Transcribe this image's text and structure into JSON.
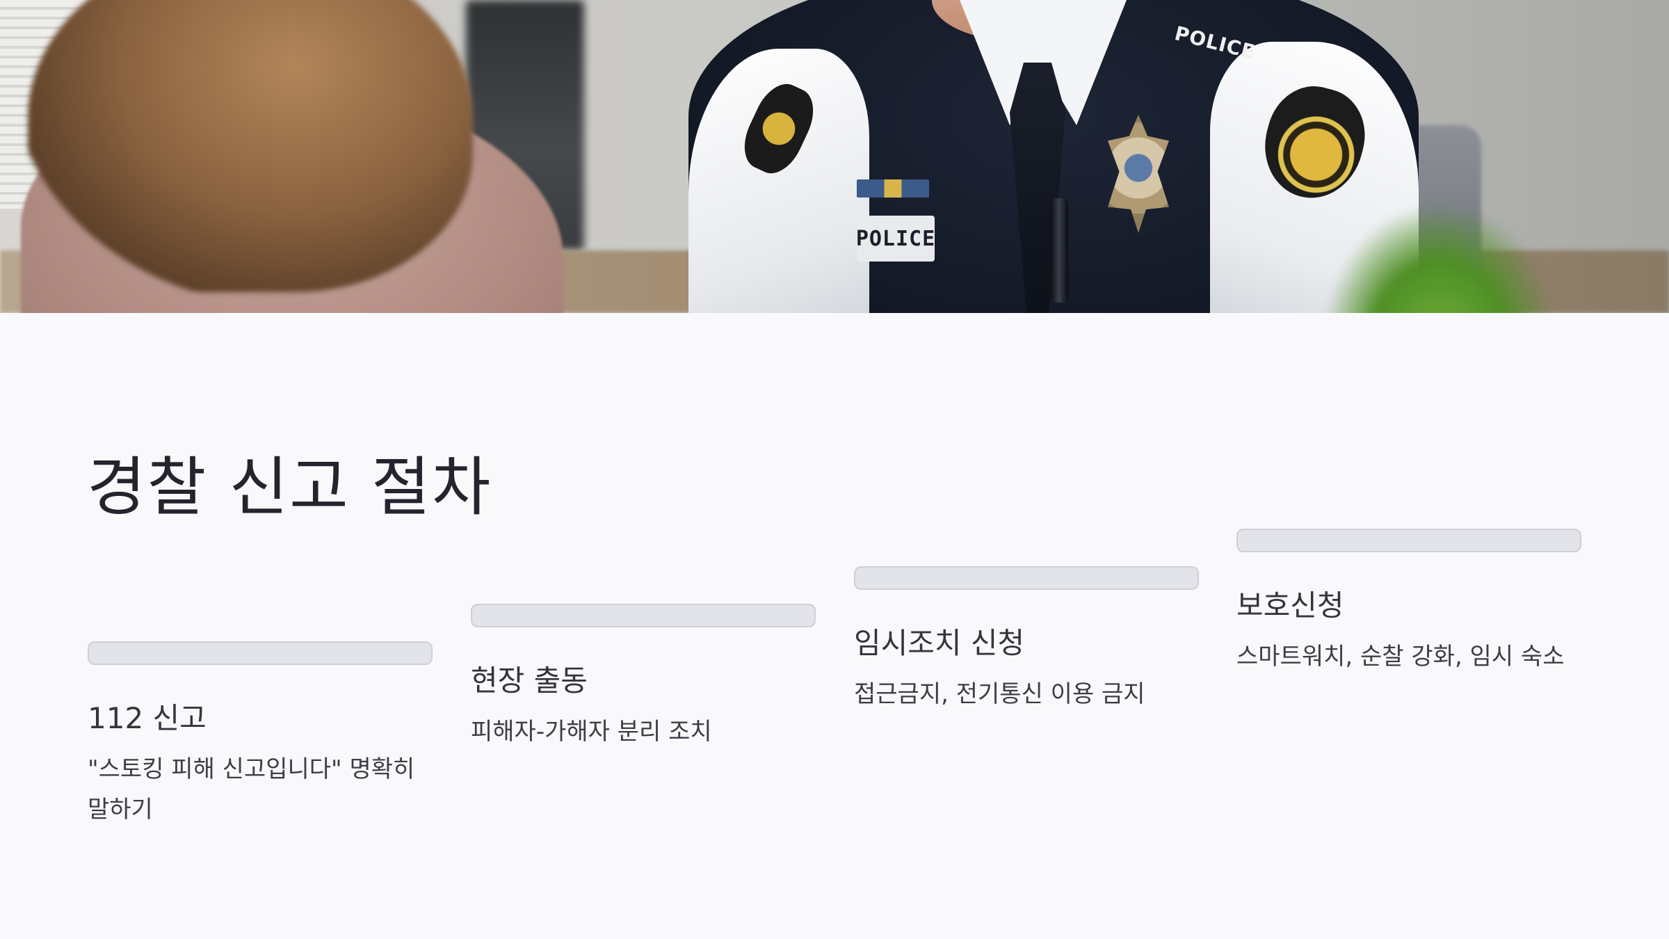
{
  "hero_image": {
    "alt": "",
    "nameplate_text": "POLICE",
    "epaulet_text": "POLICE"
  },
  "title": "경찰 신고 절차",
  "steps": [
    {
      "heading": "112 신고",
      "description": "\"스토킹 피해 신고입니다\" 명확히 말하기"
    },
    {
      "heading": "현장 출동",
      "description": "피해자-가해자 분리 조치"
    },
    {
      "heading": "임시조치 신청",
      "description": "접근금지, 전기통신 이용 금지"
    },
    {
      "heading": "보호신청",
      "description": "스마트워치, 순찰 강화, 임시 숙소"
    }
  ],
  "colors": {
    "background": "#f9f9fc",
    "bar_fill": "#e3e3ea",
    "text": "#2a2a33"
  }
}
